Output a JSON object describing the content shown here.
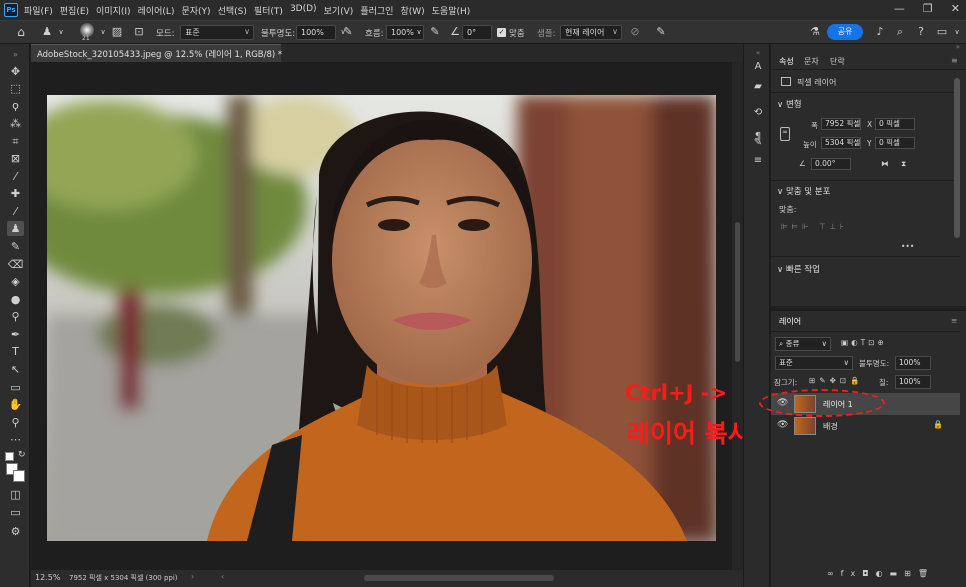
{
  "app": {
    "logo": "Ps",
    "accent": "#31a8ff",
    "share_color": "#1473e6",
    "annotation_color": "#ff1a1a"
  },
  "menu": [
    "파일(F)",
    "편집(E)",
    "이미지(I)",
    "레이어(L)",
    "문자(Y)",
    "선택(S)",
    "필터(T)",
    "3D(D)",
    "보기(V)",
    "플러그인",
    "창(W)",
    "도움말(H)"
  ],
  "options": {
    "brush_size": "21",
    "mode_label": "모드:",
    "mode_value": "표준",
    "opacity_label": "불투명도:",
    "opacity_value": "100%",
    "flow_label": "흐름:",
    "flow_value": "100%",
    "angle_value": "0°",
    "align_label": "맞춤",
    "sample_label": "샘플:",
    "sample_value": "현재 레이어",
    "share_label": "공유"
  },
  "document": {
    "tab_title": "AdobeStock_320105433.jpeg @ 12.5% (레이어 1, RGB/8) *",
    "zoom": "12.5%",
    "doc_info": "7952 픽셀 x 5304 픽셀 (300 ppi)"
  },
  "properties": {
    "tabs": [
      "속성",
      "문자",
      "단락"
    ],
    "kind": "픽셀 레이어",
    "transform_title": "변형",
    "width_label": "폭",
    "width_value": "7952 픽셀",
    "height_label": "높이",
    "height_value": "5304 픽셀",
    "x_label": "X",
    "x_value": "0 픽셀",
    "y_label": "Y",
    "y_value": "0 픽셀",
    "angle_value": "0.00°",
    "align_title": "맞춤 및 분포",
    "align_label": "맞춤:",
    "quick_title": "빠른 작업",
    "more": "•••"
  },
  "layers": {
    "tab": "레이어",
    "filter": "종류",
    "blend_mode": "표준",
    "opacity_label": "불투명도:",
    "opacity_value": "100%",
    "lock_label": "잠그기:",
    "fill_label": "칠:",
    "fill_value": "100%",
    "items": [
      {
        "name": "레이어 1",
        "selected": true
      },
      {
        "name": "배경",
        "locked": true
      }
    ],
    "bottom_icons": [
      "link-icon",
      "fx-icon",
      "mask-icon",
      "adjustment-icon",
      "group-icon",
      "new-layer-icon",
      "trash-icon"
    ]
  },
  "annotation": {
    "line1": "Ctrl+J ->",
    "line2": "레이어 복사"
  }
}
